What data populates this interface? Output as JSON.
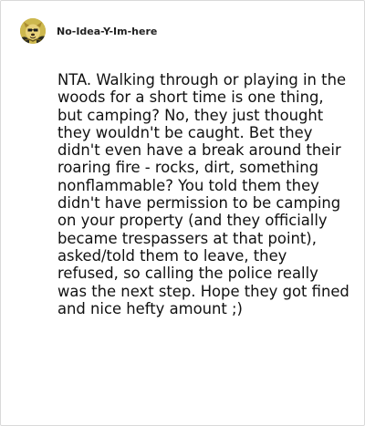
{
  "comment": {
    "username": "No-Idea-Y-Im-here",
    "avatar_icon": "cartoon-dog-avatar-icon",
    "body": "NTA. Walking through or playing in the woods for a short time is one thing, but camping? No, they just thought they wouldn't be caught. Bet they didn't even have a break around their roaring fire - rocks, dirt, something nonflammable? You told them they didn't have permission to be camping on your property (and they officially became trespassers at that point), asked/told them to leave, they refused, so calling the police really was the next step. Hope they got fined and nice hefty amount ;)"
  }
}
